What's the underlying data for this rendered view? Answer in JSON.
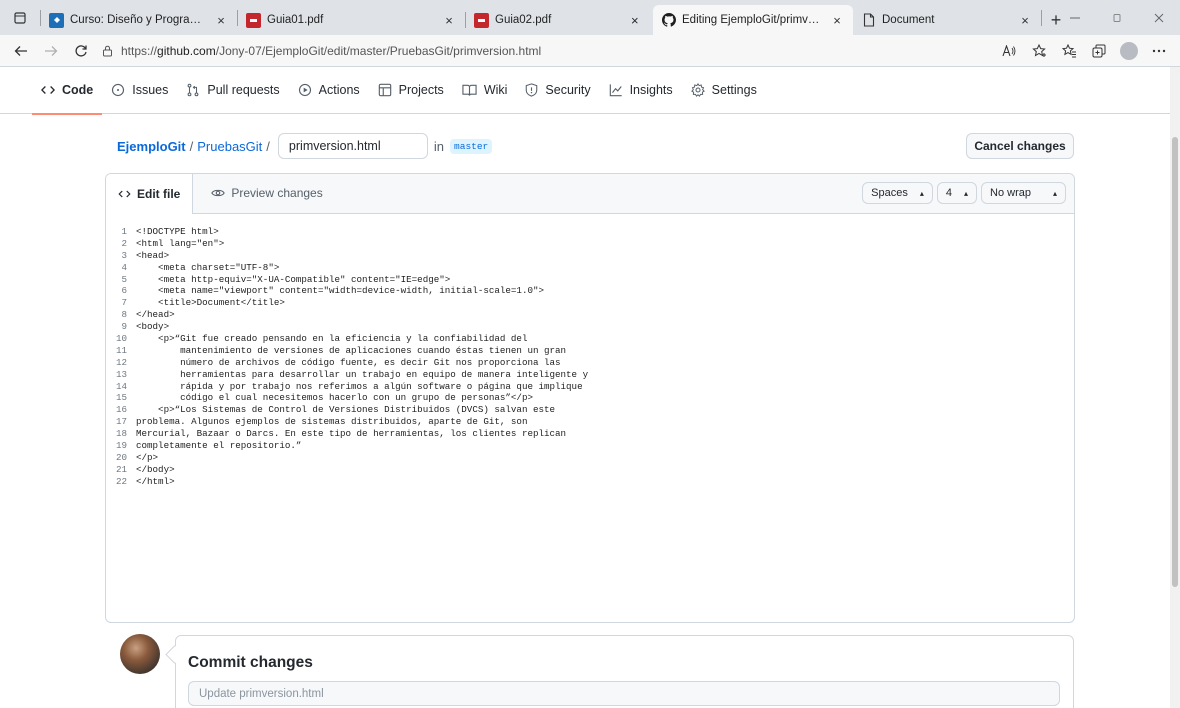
{
  "browser": {
    "tabs": [
      {
        "label": "Curso: Diseño y Programación d",
        "icon": "course-icon",
        "active": false
      },
      {
        "label": "Guia01.pdf",
        "icon": "pdf-icon",
        "active": false
      },
      {
        "label": "Guia02.pdf",
        "icon": "pdf-icon",
        "active": false
      },
      {
        "label": "Editing EjemploGit/primversion.",
        "icon": "github-icon",
        "active": true
      },
      {
        "label": "Document",
        "icon": "document-icon",
        "active": false
      }
    ],
    "close_glyph": "×",
    "new_tab_glyph": "+",
    "url_prefix": "https://",
    "url_host": "github.com",
    "url_path": "/Jony-07/EjemploGit/edit/master/PruebasGit/primversion.html"
  },
  "repo_nav": {
    "items": [
      {
        "label": "Code",
        "icon": "code-icon",
        "selected": true
      },
      {
        "label": "Issues",
        "icon": "issue-icon",
        "selected": false
      },
      {
        "label": "Pull requests",
        "icon": "pull-request-icon",
        "selected": false
      },
      {
        "label": "Actions",
        "icon": "play-icon",
        "selected": false
      },
      {
        "label": "Projects",
        "icon": "table-icon",
        "selected": false
      },
      {
        "label": "Wiki",
        "icon": "book-icon",
        "selected": false
      },
      {
        "label": "Security",
        "icon": "shield-icon",
        "selected": false
      },
      {
        "label": "Insights",
        "icon": "graph-icon",
        "selected": false
      },
      {
        "label": "Settings",
        "icon": "gear-icon",
        "selected": false
      }
    ]
  },
  "breadcrumb": {
    "owner": "EjemploGit",
    "separator": "/",
    "directory": "PruebasGit",
    "filename": "primversion.html",
    "in_label": "in",
    "branch": "master"
  },
  "actions": {
    "cancel_label": "Cancel changes"
  },
  "editor": {
    "tabs": {
      "edit": "Edit file",
      "preview": "Preview changes"
    },
    "indent_mode": "Spaces",
    "indent_size": "4",
    "wrap_mode": "No wrap",
    "lines": [
      "<!DOCTYPE html>",
      "<html lang=\"en\">",
      "<head>",
      "    <meta charset=\"UTF-8\">",
      "    <meta http-equiv=\"X-UA-Compatible\" content=\"IE=edge\">",
      "    <meta name=\"viewport\" content=\"width=device-width, initial-scale=1.0\">",
      "    <title>Document</title>",
      "</head>",
      "<body>",
      "    <p>“Git fue creado pensando en la eficiencia y la confiabilidad del",
      "        mantenimiento de versiones de aplicaciones cuando éstas tienen un gran",
      "        número de archivos de código fuente, es decir Git nos proporciona las",
      "        herramientas para desarrollar un trabajo en equipo de manera inteligente y",
      "        rápida y por trabajo nos referimos a algún software o página que implique",
      "        código el cual necesitemos hacerlo con un grupo de personas”</p>",
      "    <p>“Los Sistemas de Control de Versiones Distribuidos (DVCS) salvan este",
      "problema. Algunos ejemplos de sistemas distribuidos, aparte de Git, son",
      "Mercurial, Bazaar o Darcs. En este tipo de herramientas, los clientes replican",
      "completamente el repositorio.”",
      "</p>",
      "</body>",
      "</html>"
    ]
  },
  "commit": {
    "title": "Commit changes",
    "placeholder": "Update primversion.html"
  },
  "colors": {
    "link": "#0969da",
    "selected_underline": "#fd8c73",
    "border": "#d0d7de"
  }
}
